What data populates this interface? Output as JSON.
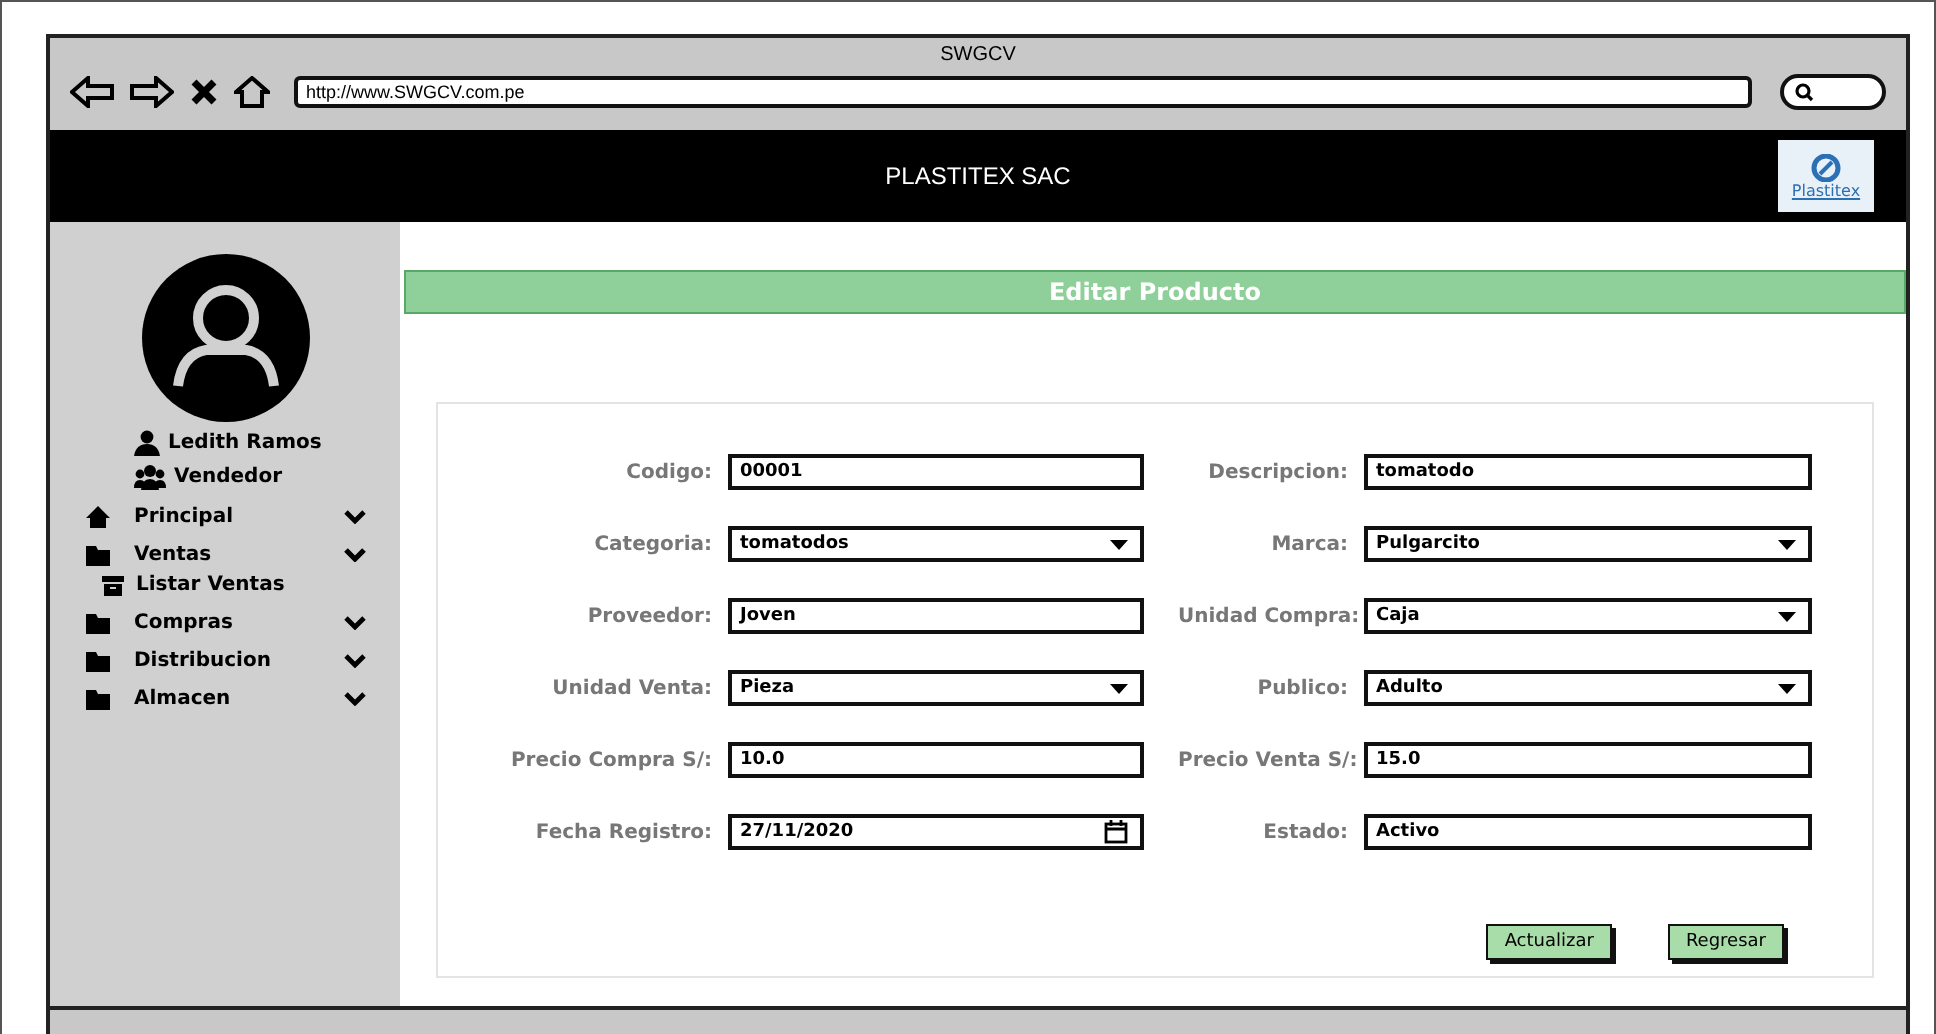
{
  "browser": {
    "title": "SWGCV",
    "url": "http://www.SWGCV.com.pe"
  },
  "header": {
    "title": "PLASTITEX SAC",
    "logo_text": "Plastitex"
  },
  "user": {
    "name": "Ledith Ramos",
    "role": "Vendedor"
  },
  "sidebar": {
    "items": [
      {
        "label": "Principal",
        "kind": "home",
        "expanded": false
      },
      {
        "label": "Ventas",
        "kind": "folder",
        "expanded": true,
        "children": [
          {
            "label": "Listar Ventas"
          }
        ]
      },
      {
        "label": "Compras",
        "kind": "folder",
        "expanded": false
      },
      {
        "label": "Distribucion",
        "kind": "folder",
        "expanded": false
      },
      {
        "label": "Almacen",
        "kind": "folder",
        "expanded": false
      }
    ]
  },
  "page_title": "Editar Producto",
  "form": {
    "left": [
      {
        "label": "Codigo:",
        "kind": "text",
        "value": "00001"
      },
      {
        "label": "Categoria:",
        "kind": "select",
        "value": "tomatodos"
      },
      {
        "label": "Proveedor:",
        "kind": "text",
        "value": "Joven"
      },
      {
        "label": "Unidad Venta:",
        "kind": "select",
        "value": "Pieza"
      },
      {
        "label": "Precio Compra S/:",
        "kind": "text",
        "value": "10.0"
      },
      {
        "label": "Fecha Registro:",
        "kind": "date",
        "value": "27/11/2020"
      }
    ],
    "right": [
      {
        "label": "Descripcion:",
        "kind": "text",
        "value": "tomatodo"
      },
      {
        "label": "Marca:",
        "kind": "select",
        "value": "Pulgarcito"
      },
      {
        "label": "Unidad Compra:",
        "kind": "select",
        "value": "Caja"
      },
      {
        "label": "Publico:",
        "kind": "select",
        "value": "Adulto"
      },
      {
        "label": "Precio Venta S/:",
        "kind": "text",
        "value": "15.0"
      },
      {
        "label": "Estado:",
        "kind": "text",
        "value": "Activo"
      }
    ]
  },
  "buttons": [
    "Actualizar",
    "Regresar"
  ]
}
